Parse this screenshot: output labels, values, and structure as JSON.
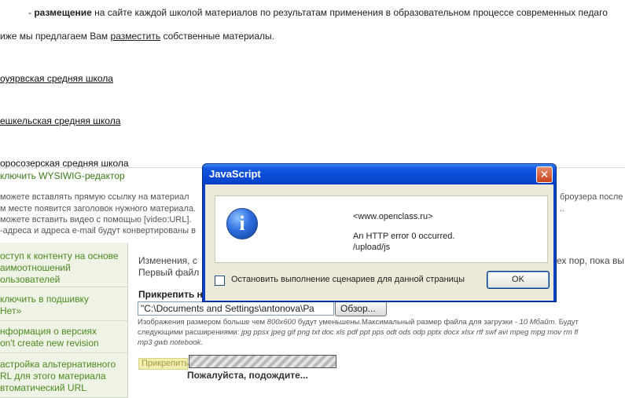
{
  "top": {
    "prefix": "- ",
    "bold_word": "размещение",
    "rest": " на сайте каждой школой материалов по результатам применения в образовательном процессе современных педаго"
  },
  "intro": {
    "pre": "иже мы предлагаем Вам ",
    "underlined": "разместить",
    "post": " собственные материалы."
  },
  "schools": [
    "оуярвская средняя школа",
    "ешкельская средняя школа",
    "оросозерская средняя школа"
  ],
  "editor": {
    "wysiwyg_link": "ключить WYSIWIG-редактор"
  },
  "help_lines": [
    "можете вставлять прямую ссылку на материал",
    "м месте появится заголовок нужного материала.",
    "можете вставить видео с помощью [video:URL].",
    "-адреса и адреса e-mail будут конвертированы в"
  ],
  "right_fragments": [
    "броузера после",
    ".. "
  ],
  "side_items": [
    [
      "оступ к контенту на основе",
      "аимоотношений",
      "ользователей"
    ],
    [
      "ключить в подшивку",
      "Нет»"
    ],
    [
      "нформация о версиях",
      "on't create new revision"
    ],
    [
      "астройка альтернативного",
      "RL для этого материала",
      "втоматический URL"
    ]
  ],
  "attachments": {
    "right_line_1a": "Изменения, с",
    "right_line_1b": "ех пор, пока вы",
    "right_line_2": "Первый файл",
    "attach_label": "Прикрепить н",
    "file_value": "\"C:\\Documents and Settings\\antonova\\Ра",
    "browse_label": "Обзор...",
    "size_note_pre": "Изображения размером больше чем ",
    "size_note_dim": "800x600",
    "size_note_mid": " будут уменьшены.Максимальный размер файла для загрузки - ",
    "size_note_max": "10 Мбайт",
    "size_note_post": ". Будут",
    "size_note_ext_label": "следующими расширениями: ",
    "size_note_ext": "jpg ppsx jpeg gif png txt doc xls pdf ppt pps odt ods odp pptx docx xlsx rtf swf avi mpeg mpg mov rm fl",
    "size_note_ext2": "mp3 gwb notebook.",
    "attach_button": "Прикрепить",
    "wait_text": "Пожалуйста, подождите..."
  },
  "dialog": {
    "title": "JavaScript",
    "close_glyph": "✕",
    "icon_glyph": "i",
    "lines": [
      "<www.openclass.ru>",
      "An HTTP error 0 occurred.",
      "/upload/js"
    ],
    "checkbox_label": "Остановить выполнение сценариев для данной страницы",
    "ok_label": "OK"
  }
}
